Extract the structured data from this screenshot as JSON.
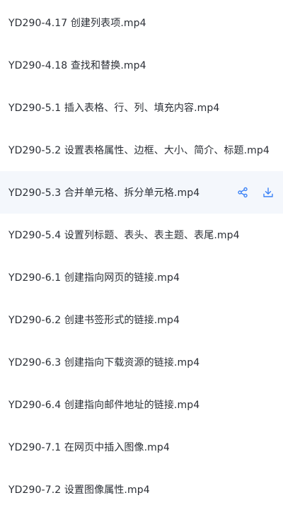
{
  "files": [
    {
      "name": "YD290-4.17 创建列表项.mp4"
    },
    {
      "name": "YD290-4.18 查找和替换.mp4"
    },
    {
      "name": "YD290-5.1 插入表格、行、列、填充内容.mp4"
    },
    {
      "name": "YD290-5.2 设置表格属性、边框、大小、简介、标题.mp4"
    },
    {
      "name": "YD290-5.3 合并单元格、拆分单元格.mp4"
    },
    {
      "name": "YD290-5.4 设置列标题、表头、表主题、表尾.mp4"
    },
    {
      "name": "YD290-6.1 创建指向网页的链接.mp4"
    },
    {
      "name": "YD290-6.2 创建书签形式的链接.mp4"
    },
    {
      "name": "YD290-6.3 创建指向下载资源的链接.mp4"
    },
    {
      "name": "YD290-6.4 创建指向邮件地址的链接.mp4"
    },
    {
      "name": "YD290-7.1 在网页中插入图像.mp4"
    },
    {
      "name": "YD290-7.2 设置图像属性.mp4"
    }
  ],
  "hovered_row": {
    "index": 4,
    "actions": [
      {
        "icon": "share-icon"
      },
      {
        "icon": "download-icon"
      }
    ]
  },
  "colors": {
    "text": "#2b2f36",
    "hover_background": "#f4f7fc",
    "accent": "#3b82f6"
  }
}
